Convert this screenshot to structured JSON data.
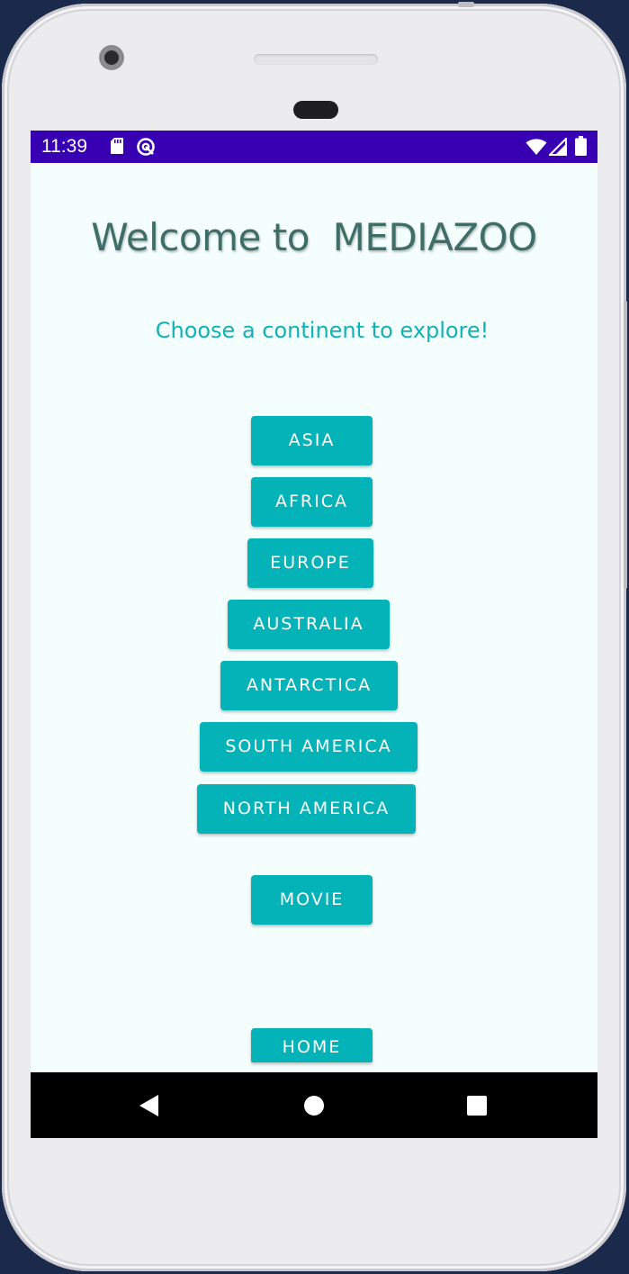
{
  "status_bar": {
    "time": "11:39",
    "background_color": "#3700b3",
    "left_icons": [
      "sd-card-icon",
      "sync-disabled-icon"
    ],
    "right_icons": [
      "wifi-icon",
      "signal-icon",
      "battery-icon"
    ]
  },
  "app": {
    "title": "Welcome to  MEDIAZOO",
    "subtitle": "Choose a continent to explore!",
    "accent_color": "#04b3b8",
    "background_color": "#f4fffd"
  },
  "continent_buttons": [
    {
      "label": "ASIA"
    },
    {
      "label": "AFRICA"
    },
    {
      "label": "EUROPE"
    },
    {
      "label": "AUSTRALIA"
    },
    {
      "label": "ANTARCTICA"
    },
    {
      "label": "SOUTH AMERICA"
    },
    {
      "label": "NORTH AMERICA"
    }
  ],
  "movie_button": {
    "label": "MOVIE"
  },
  "home_button": {
    "label": "HOME"
  },
  "nav_bar": {
    "buttons": [
      "back-icon",
      "home-circle-icon",
      "recents-icon"
    ]
  }
}
